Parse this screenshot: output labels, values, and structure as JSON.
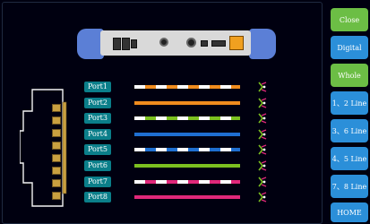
{
  "buttons": {
    "close": "Close",
    "digital": "Digital",
    "whole": "Whole",
    "line12": "1、2 Line",
    "line36": "3、6 Line",
    "line45": "4、5 Line",
    "line78": "7、8 Line",
    "home": "HOME"
  },
  "ports": [
    {
      "label": "Port1",
      "pattern": "striped",
      "color": "#f08c1e"
    },
    {
      "label": "Port2",
      "pattern": "solid",
      "color": "#f08c1e"
    },
    {
      "label": "Port3",
      "pattern": "striped",
      "color": "#7cc020"
    },
    {
      "label": "Port4",
      "pattern": "solid",
      "color": "#1f6fd0"
    },
    {
      "label": "Port5",
      "pattern": "striped",
      "color": "#1f6fd0"
    },
    {
      "label": "Port6",
      "pattern": "solid",
      "color": "#7cc020"
    },
    {
      "label": "Port7",
      "pattern": "striped",
      "color": "#e0287a"
    },
    {
      "label": "Port8",
      "pattern": "solid",
      "color": "#e0287a"
    }
  ],
  "colors": {
    "accent_green": "#6cbe45",
    "accent_blue": "#2b8fd9",
    "port_label_bg": "#0b7f8a"
  }
}
